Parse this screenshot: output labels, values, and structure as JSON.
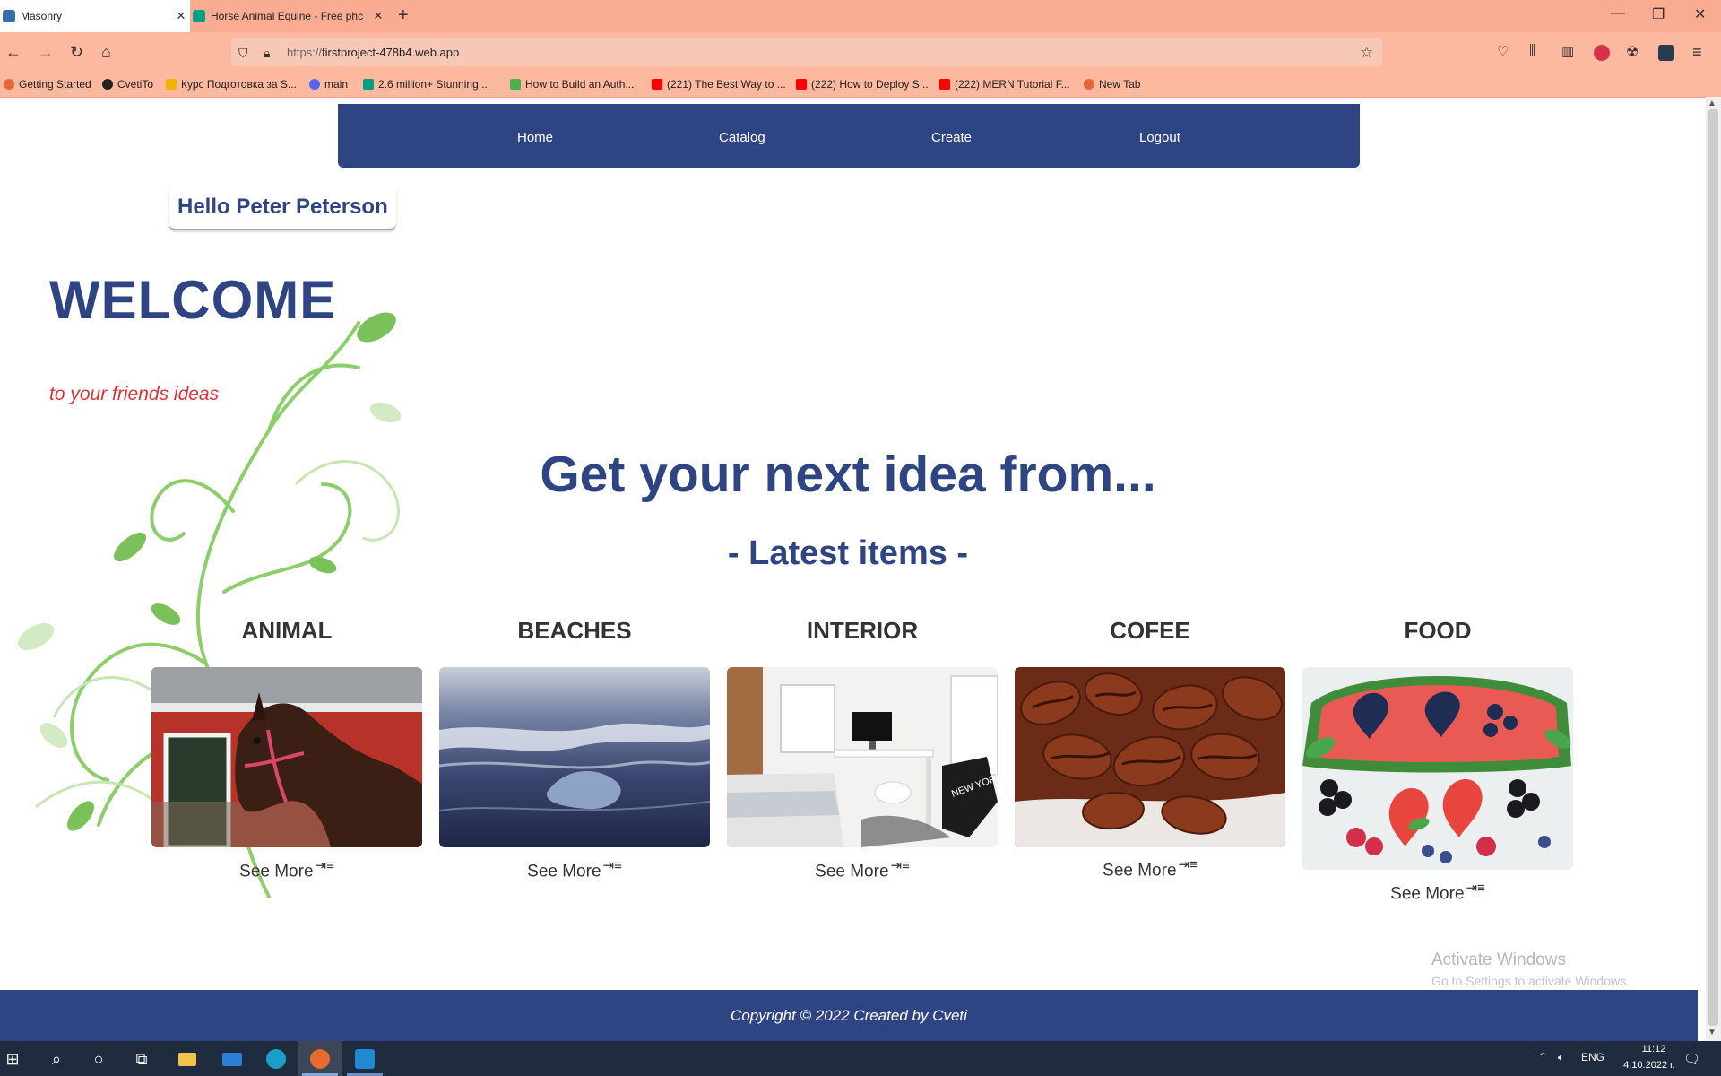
{
  "browser": {
    "tabs": [
      {
        "title": "Masonry",
        "active": true
      },
      {
        "title": "Horse Animal Equine - Free phc",
        "active": false
      }
    ],
    "url_prefix": "https://",
    "url_host": "firstproject-478b4.web.app",
    "bookmarks": [
      "Getting Started",
      "CvetiTo",
      "Курс Подготовка за S...",
      "main",
      "2.6 million+ Stunning ...",
      "How to Build an Auth...",
      "(221) The Best Way to ...",
      "(222) How to Deploy S...",
      "(222) MERN Tutorial F...",
      "New Tab"
    ]
  },
  "nav": {
    "home": "Home",
    "catalog": "Catalog",
    "create": "Create",
    "logout": "Logout"
  },
  "greeting": "Hello Peter Peterson",
  "hero": {
    "welcome": "WELCOME",
    "tagline": "to your friends ideas"
  },
  "headline": "Get your next idea from...",
  "latest": "- Latest items -",
  "cards": [
    {
      "title": "ANIMAL",
      "link": "See More",
      "image": "horse-photo"
    },
    {
      "title": "BEACHES",
      "link": "See More",
      "image": "ocean-waves-photo"
    },
    {
      "title": "INTERIOR",
      "link": "See More",
      "image": "bedroom-desk-photo"
    },
    {
      "title": "COFEE",
      "link": "See More",
      "image": "coffee-beans-photo"
    },
    {
      "title": "FOOD",
      "link": "See More",
      "image": "watermelon-berries-photo"
    }
  ],
  "activate": {
    "line1": "Activate Windows",
    "line2": "Go to Settings to activate Windows."
  },
  "footer": "Copyright © 2022 Created by Cveti",
  "taskbar": {
    "lang": "ENG",
    "time": "11:12",
    "date": "4.10.2022 г."
  },
  "colors": {
    "brand": "#2f4583",
    "accent_red": "#d9343a",
    "browser_chrome": "#f9ac92"
  }
}
